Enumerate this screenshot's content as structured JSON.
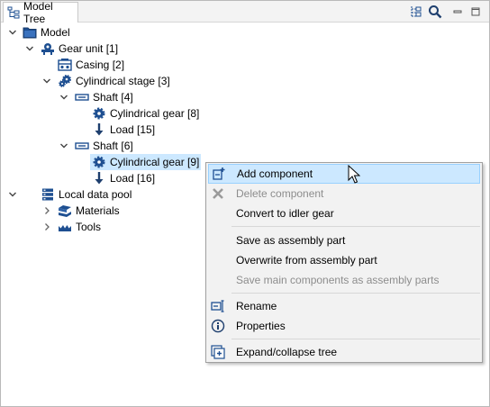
{
  "panel": {
    "tab_label": "Model Tree",
    "tab_icon": "model-tree-icon",
    "toolbar_icons": [
      "tree-filter-icon",
      "search-icon",
      "minimize-icon",
      "maximize-icon"
    ]
  },
  "tree": {
    "nodes": [
      {
        "label": "Model",
        "icon": "folder-icon",
        "expanded": true
      },
      {
        "label": "Gear unit [1]",
        "icon": "gear-unit-icon",
        "expanded": true
      },
      {
        "label": "Casing [2]",
        "icon": "casing-icon"
      },
      {
        "label": "Cylindrical stage [3]",
        "icon": "cylindrical-stage-icon",
        "expanded": true
      },
      {
        "label": "Shaft [4]",
        "icon": "shaft-icon",
        "expanded": true
      },
      {
        "label": "Cylindrical gear [8]",
        "icon": "cylindrical-gear-icon"
      },
      {
        "label": "Load [15]",
        "icon": "load-arrow-icon"
      },
      {
        "label": "Shaft [6]",
        "icon": "shaft-icon",
        "expanded": true
      },
      {
        "label": "Cylindrical gear [9]",
        "icon": "cylindrical-gear-icon",
        "selected": true
      },
      {
        "label": "Load [16]",
        "icon": "load-arrow-icon"
      },
      {
        "label": "Local data pool",
        "icon": "database-icon",
        "expanded": true
      },
      {
        "label": "Materials",
        "icon": "materials-icon",
        "expanded": false
      },
      {
        "label": "Tools",
        "icon": "tools-icon",
        "expanded": false
      }
    ]
  },
  "context_menu": {
    "items": [
      {
        "label": "Add component",
        "icon": "add-component-icon",
        "enabled": true,
        "hovered": true
      },
      {
        "label": "Delete component",
        "icon": "delete-x-icon",
        "enabled": false
      },
      {
        "label": "Convert to idler gear",
        "enabled": true
      },
      {
        "label": "Save as assembly part",
        "enabled": true
      },
      {
        "label": "Overwrite from assembly part",
        "enabled": true
      },
      {
        "label": "Save main components as assembly parts",
        "enabled": false
      },
      {
        "label": "Rename",
        "icon": "rename-icon",
        "enabled": true
      },
      {
        "label": "Properties",
        "icon": "info-icon",
        "enabled": true
      },
      {
        "label": "Expand/collapse tree",
        "icon": "expand-collapse-icon",
        "enabled": true
      }
    ]
  },
  "colors": {
    "selection": "#cce8ff",
    "menu_hover": "#cce8ff",
    "menu_bg": "#f2f2f2",
    "icon_blue": "#1e4f91",
    "disabled_text": "#8d8d8d"
  }
}
